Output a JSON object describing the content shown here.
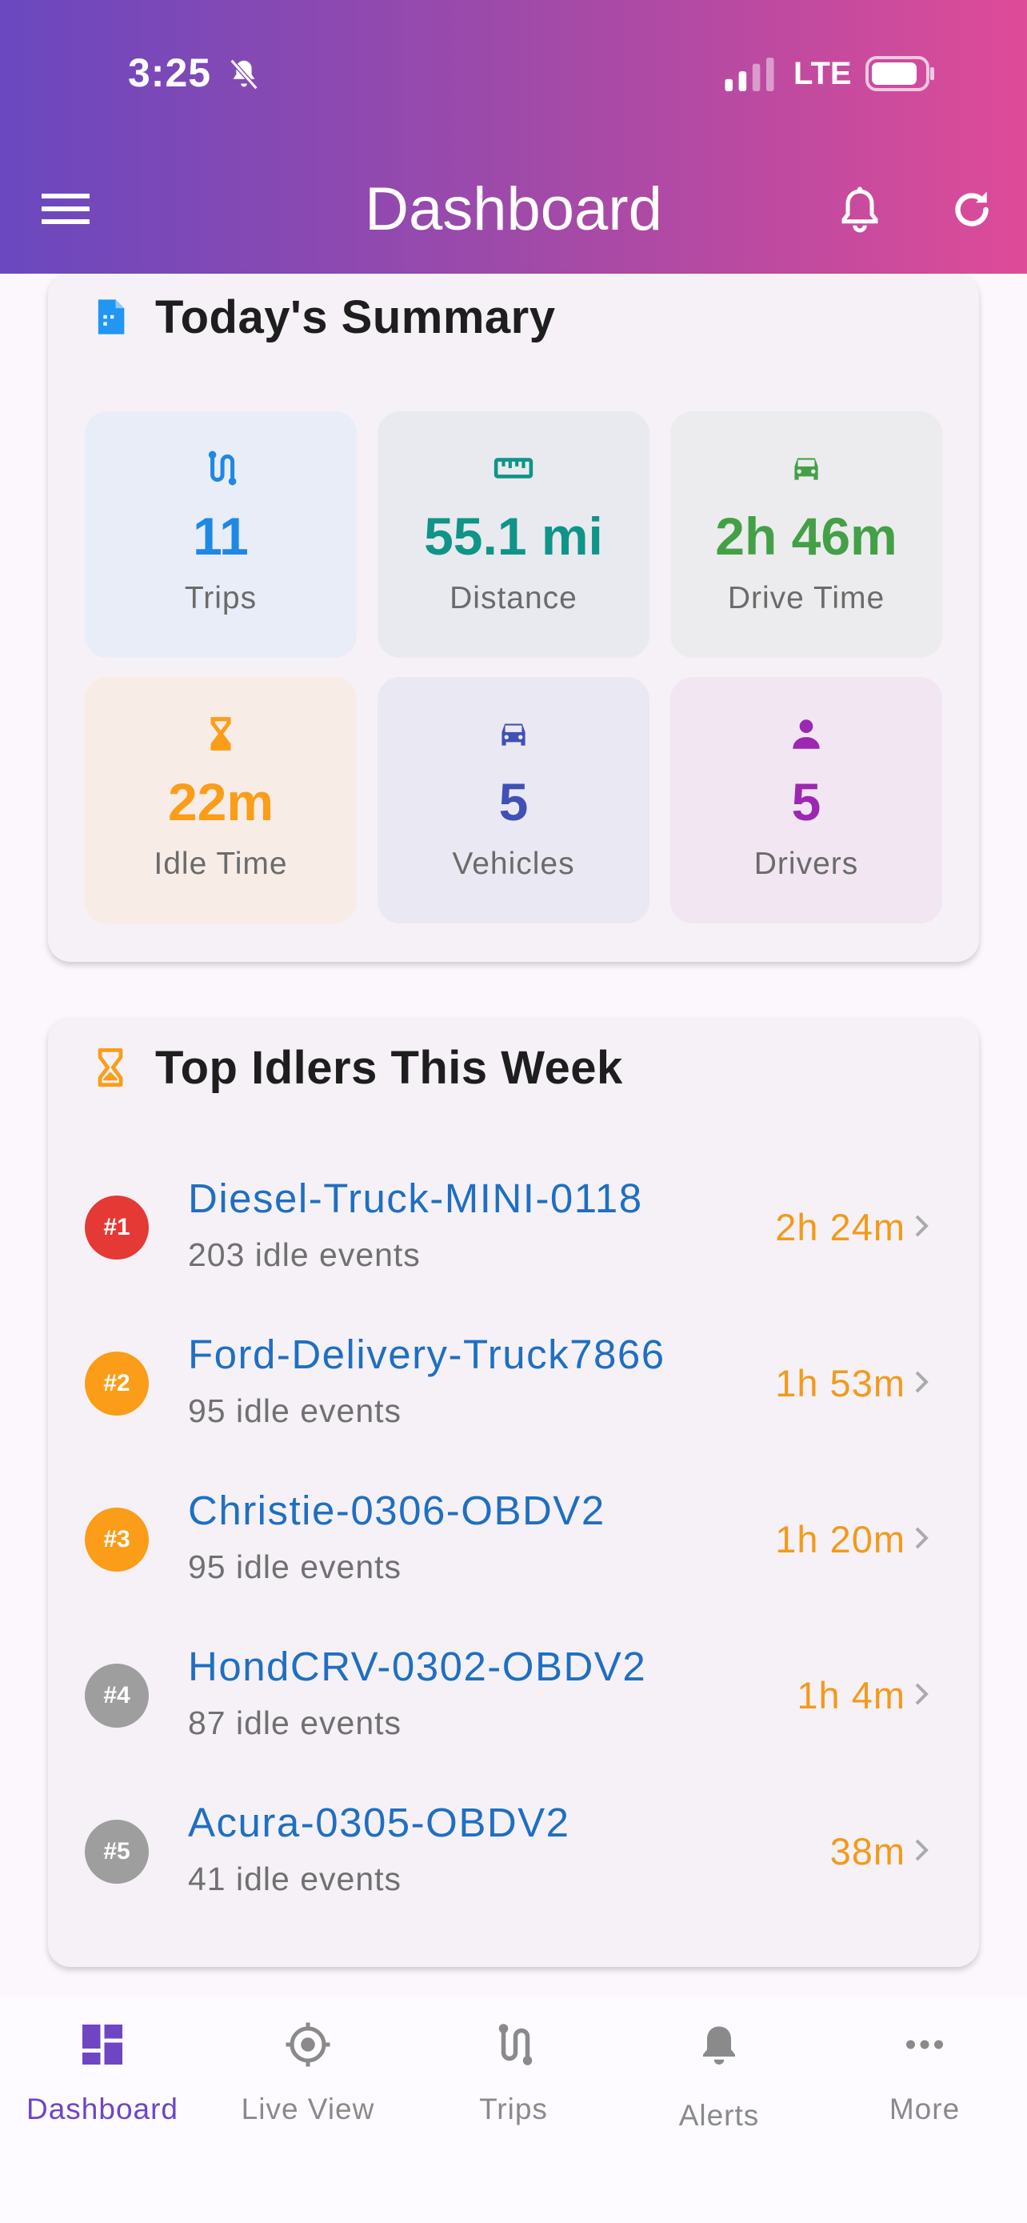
{
  "status_bar": {
    "time": "3:25",
    "network": "LTE"
  },
  "header": {
    "title": "Dashboard"
  },
  "summary": {
    "title": "Today's Summary",
    "tiles": [
      {
        "value": "11",
        "label": "Trips",
        "color": "#1e88e5"
      },
      {
        "value": "55.1 mi",
        "label": "Distance",
        "color": "#0f9488"
      },
      {
        "value": "2h 46m",
        "label": "Drive Time",
        "color": "#43a047"
      },
      {
        "value": "22m",
        "label": "Idle Time",
        "color": "#fb9d18"
      },
      {
        "value": "5",
        "label": "Vehicles",
        "color": "#3f51b5"
      },
      {
        "value": "5",
        "label": "Drivers",
        "color": "#9c27b0"
      }
    ]
  },
  "top_idlers": {
    "title": "Top Idlers This Week",
    "items": [
      {
        "rank": "#1",
        "vehicle": "Diesel-Truck-MINI-0118",
        "events": "203 idle events",
        "duration": "2h 24m",
        "color": "#e53935"
      },
      {
        "rank": "#2",
        "vehicle": "Ford-Delivery-Truck7866",
        "events": "95 idle events",
        "duration": "1h 53m",
        "color": "#fb9d18"
      },
      {
        "rank": "#3",
        "vehicle": "Christie-0306-OBDV2",
        "events": "95 idle events",
        "duration": "1h 20m",
        "color": "#fb9d18"
      },
      {
        "rank": "#4",
        "vehicle": "HondCRV-0302-OBDV2",
        "events": "87 idle events",
        "duration": "1h 4m",
        "color": "#9e9e9e"
      },
      {
        "rank": "#5",
        "vehicle": "Acura-0305-OBDV2",
        "events": "41 idle events",
        "duration": "38m",
        "color": "#9e9e9e"
      }
    ]
  },
  "bottom_nav": [
    {
      "label": "Dashboard",
      "icon": "dashboard-icon",
      "active": true
    },
    {
      "label": "Live View",
      "icon": "crosshair-icon",
      "active": false
    },
    {
      "label": "Trips",
      "icon": "route-icon",
      "active": false
    },
    {
      "label": "Alerts",
      "icon": "bell-icon",
      "active": false
    },
    {
      "label": "More",
      "icon": "more-horizontal-icon",
      "active": false
    }
  ]
}
